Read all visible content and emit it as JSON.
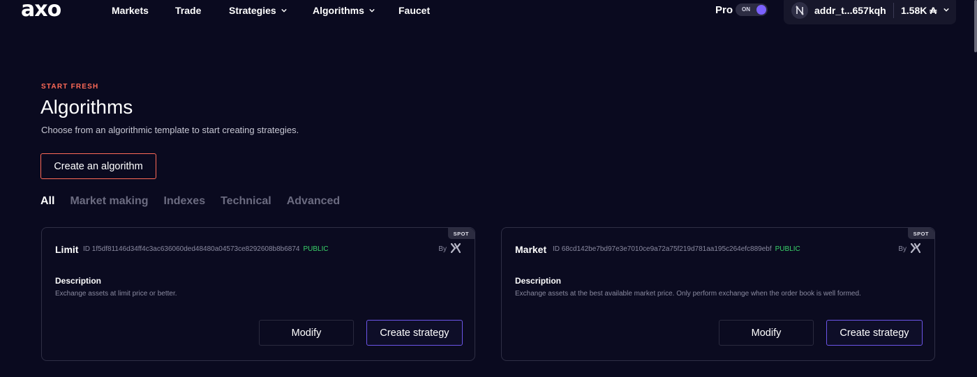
{
  "header": {
    "logo": "axo",
    "nav": [
      {
        "label": "Markets"
      },
      {
        "label": "Trade"
      },
      {
        "label": "Strategies",
        "has_dropdown": true
      },
      {
        "label": "Algorithms",
        "has_dropdown": true
      },
      {
        "label": "Faucet"
      }
    ],
    "pro_label": "Pro",
    "pro_toggle": {
      "text": "ON",
      "state": true,
      "color": "#7b61ff"
    },
    "wallet": {
      "avatar_icon": "wallet-n-icon",
      "address": "addr_t...657kqh",
      "balance": "1.58K ₳"
    }
  },
  "hero": {
    "eyebrow": "START FRESH",
    "title": "Algorithms",
    "subtitle": "Choose from an algorithmic template to start creating strategies.",
    "create_button": "Create an algorithm"
  },
  "tabs": [
    {
      "label": "All",
      "active": true
    },
    {
      "label": "Market making",
      "active": false
    },
    {
      "label": "Indexes",
      "active": false
    },
    {
      "label": "Technical",
      "active": false
    },
    {
      "label": "Advanced",
      "active": false
    }
  ],
  "cards": [
    {
      "badge": "SPOT",
      "name": "Limit",
      "id_label": "ID",
      "id": "1f5df81146d34ff4c3ac636060ded48480a04573ce8292608b8b6874",
      "visibility": "PUBLIC",
      "by_label": "By",
      "description_label": "Description",
      "description": "Exchange assets at limit price or better.",
      "modify_label": "Modify",
      "create_label": "Create strategy"
    },
    {
      "badge": "SPOT",
      "name": "Market",
      "id_label": "ID",
      "id": "68cd142be7bd97e3e7010ce9a72a75f219d781aa195c264efc889ebf",
      "visibility": "PUBLIC",
      "by_label": "By",
      "description_label": "Description",
      "description": "Exchange assets at the best available market price. Only perform exchange when the order book is well formed.",
      "modify_label": "Modify",
      "create_label": "Create strategy"
    }
  ],
  "colors": {
    "background": "#0a0a1f",
    "accent": "#ff6a57",
    "primary": "#7b61ff",
    "public": "#3ad36a"
  }
}
